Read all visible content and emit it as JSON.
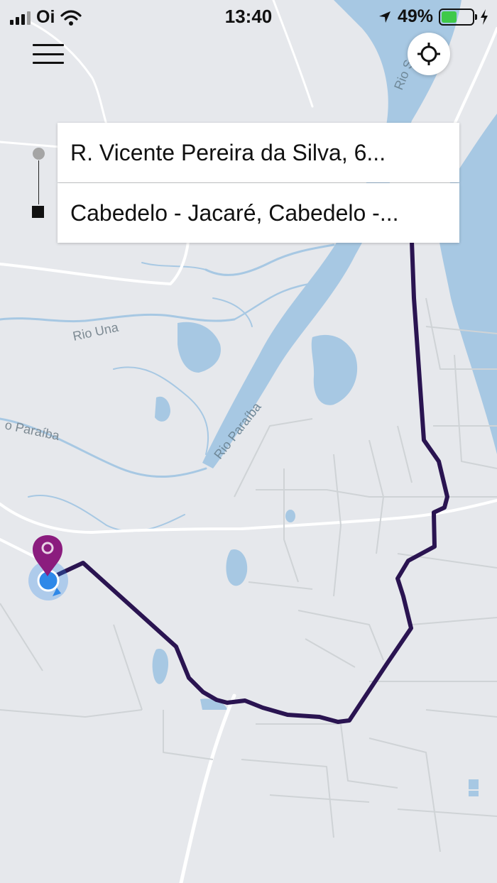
{
  "status_bar": {
    "carrier": "Oi",
    "time": "13:40",
    "battery_percent_label": "49%",
    "battery_level": 0.49
  },
  "route": {
    "pickup_address": "R. Vicente Pereira da Silva, 6...",
    "destination_address": "Cabedelo - Jacaré, Cabedelo -..."
  },
  "map": {
    "labels": {
      "rio_sanhaua_top": "Rio S",
      "rio_una": "Rio Una",
      "rio_paraiba_left": "o Paraíba",
      "rio_paraiba_center": "Rio Paraíba"
    }
  },
  "colors": {
    "map_land": "#e6e8ec",
    "water": "#a7c8e3",
    "road": "#ffffff",
    "route": "#2a1451",
    "destination_pin": "#8b1c7e",
    "current_location": "#2e88e8",
    "battery_fill": "#3ec94a"
  },
  "icons": {
    "menu": "hamburger-menu-icon",
    "locate": "crosshair-locate-icon",
    "signal": "signal-bars-icon",
    "wifi": "wifi-icon",
    "location_arrow": "location-arrow-icon",
    "charging": "charging-bolt-icon",
    "pin": "map-pin-icon"
  }
}
